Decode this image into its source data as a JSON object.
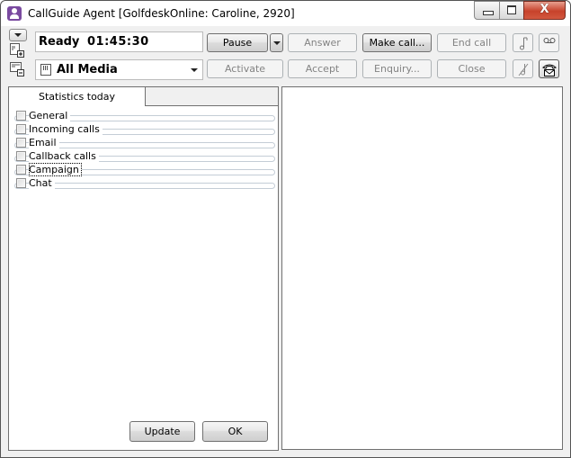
{
  "window": {
    "title": "CallGuide Agent [GolfdeskOnline: Caroline, 2920]",
    "controls": {
      "minimize": "minimize",
      "maximize": "maximize",
      "close": "X"
    }
  },
  "toolbar": {
    "status": {
      "state": "Ready",
      "time": "01:45:30"
    },
    "media": {
      "selected": "All Media"
    },
    "buttons": {
      "pause": "Pause",
      "answer": "Answer",
      "make_call": "Make call...",
      "end_call": "End call",
      "activate": "Activate",
      "accept": "Accept",
      "enquiry": "Enquiry...",
      "close": "Close"
    },
    "icons": [
      "dropdown-toggle-icon",
      "add-panel-icon",
      "remove-panel-icon",
      "music-note-icon",
      "voicemail-icon",
      "no-music-icon",
      "phone-mail-icon"
    ]
  },
  "statistics": {
    "tab_label": "Statistics today",
    "items": [
      {
        "label": "General",
        "checked": false
      },
      {
        "label": "Incoming calls",
        "checked": false
      },
      {
        "label": "Email",
        "checked": false
      },
      {
        "label": "Callback calls",
        "checked": false
      },
      {
        "label": "Campaign",
        "checked": false,
        "focused": true
      },
      {
        "label": "Chat",
        "checked": false
      }
    ],
    "update_label": "Update",
    "ok_label": "OK"
  }
}
